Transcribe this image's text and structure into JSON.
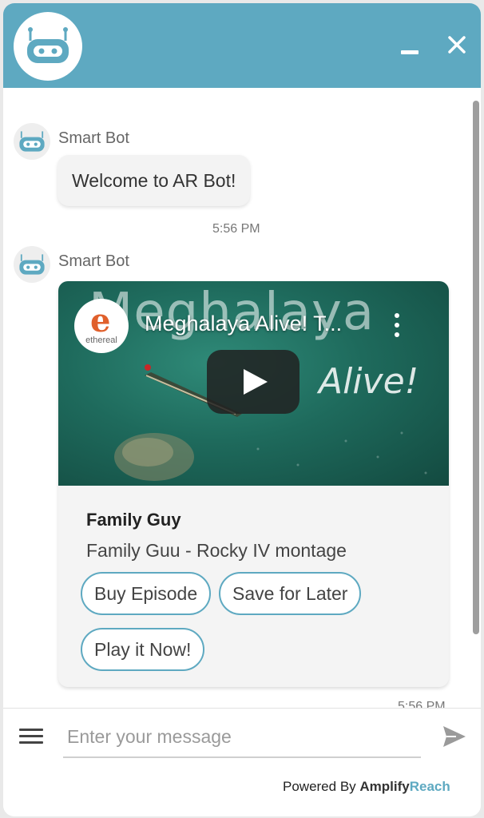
{
  "header": {
    "avatar_icon": "robot-icon",
    "minimize_icon": "minimize-icon",
    "close_icon": "close-icon",
    "accent_color": "#5ea9c1"
  },
  "messages": [
    {
      "sender": "Smart Bot",
      "avatar_icon": "robot-icon",
      "text": "Welcome to AR Bot!",
      "time": "5:56 PM"
    },
    {
      "sender": "Smart Bot",
      "avatar_icon": "robot-icon",
      "time": "5:56 PM",
      "card": {
        "video": {
          "overlay_title": "Meghalaya",
          "overlay_subtitle": "Alive!",
          "channel_letter": "e",
          "channel_name": "ethereal",
          "title": "Meghalaya Alive! T...",
          "menu_icon": "more-vertical-icon",
          "play_icon": "play-icon"
        },
        "title": "Family Guy",
        "subtitle": "Family Guu - Rocky IV montage",
        "buttons": [
          "Buy Episode",
          "Save for Later",
          "Play it Now!"
        ]
      }
    }
  ],
  "composer": {
    "menu_icon": "hamburger-menu-icon",
    "placeholder": "Enter your message",
    "send_icon": "send-icon"
  },
  "powered_by": {
    "prefix": "Powered By",
    "brand_1": "Amplify",
    "brand_2": "Reach"
  }
}
